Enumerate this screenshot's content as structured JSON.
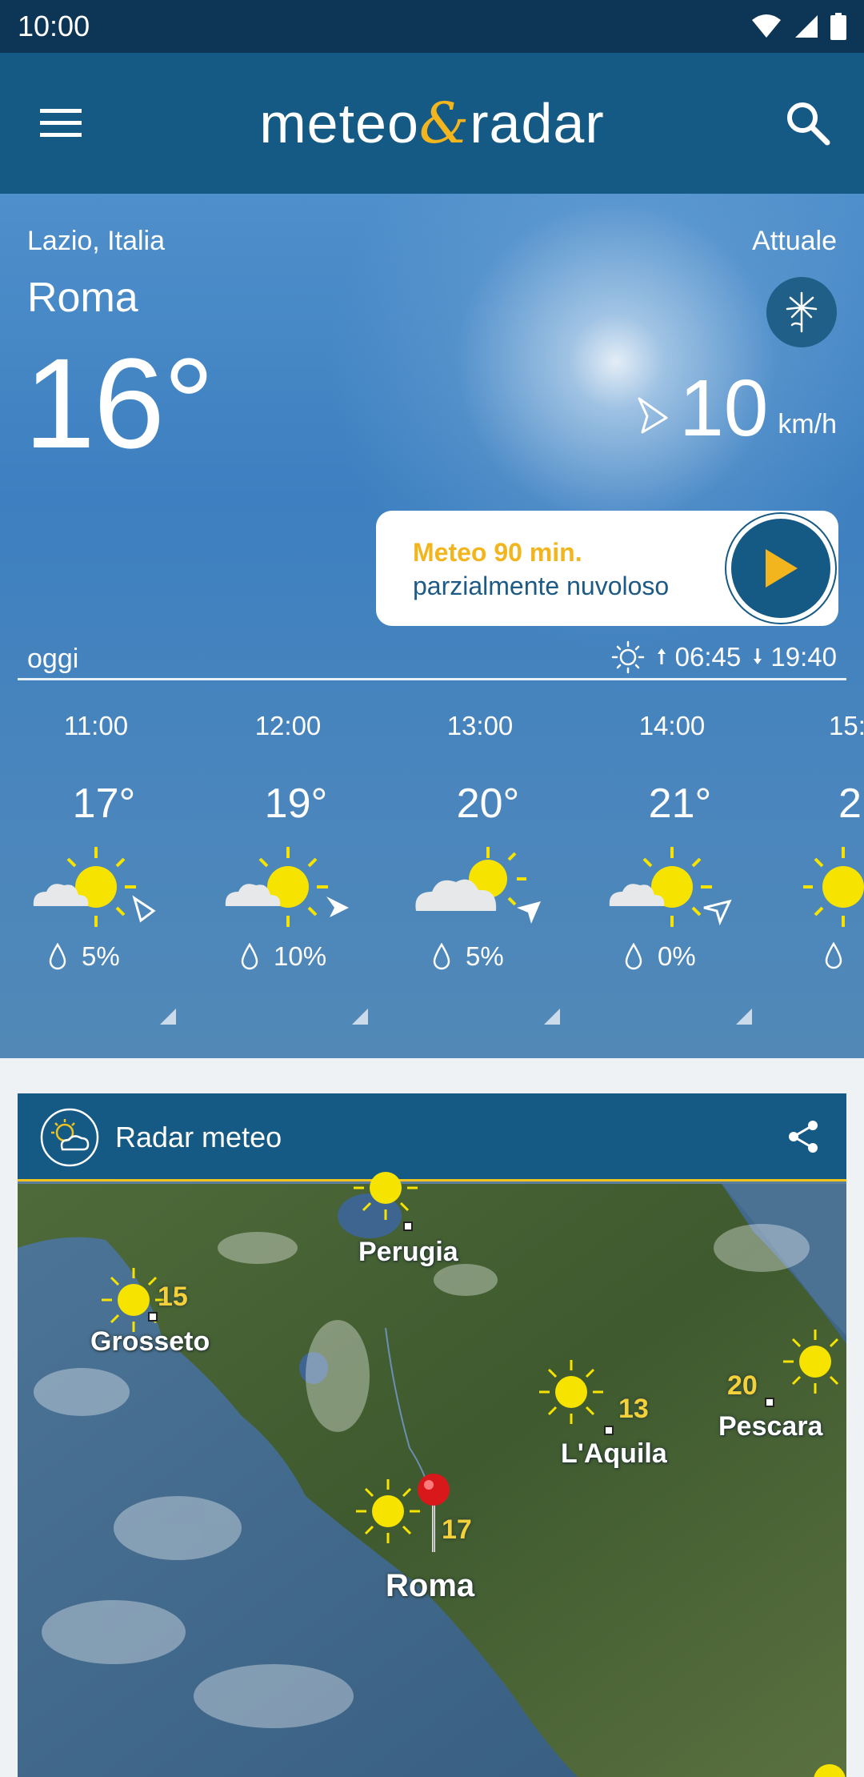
{
  "status_bar": {
    "time": "10:00"
  },
  "app_bar": {
    "brand_left": "meteo",
    "brand_amp": "&",
    "brand_right": "radar"
  },
  "current": {
    "region": "Lazio, Italia",
    "label": "Attuale",
    "city": "Roma",
    "temperature": "16°",
    "wind_speed": "10",
    "wind_unit": "km/h"
  },
  "nowcast": {
    "title": "Meteo 90 min.",
    "description": "parzialmente nuvoloso"
  },
  "today": {
    "label": "oggi",
    "sunrise": "06:45",
    "sunset": "19:40"
  },
  "hourly": [
    {
      "time": "11:00",
      "temp": "17°",
      "rain": "5%",
      "icon": "partly-sunny-icon"
    },
    {
      "time": "12:00",
      "temp": "19°",
      "rain": "10%",
      "icon": "partly-sunny-icon"
    },
    {
      "time": "13:00",
      "temp": "20°",
      "rain": "5%",
      "icon": "partly-cloudy-icon"
    },
    {
      "time": "14:00",
      "temp": "21°",
      "rain": "0%",
      "icon": "partly-sunny-icon"
    },
    {
      "time": "15:",
      "temp": "2",
      "rain": "",
      "icon": "sunny-icon"
    }
  ],
  "radar": {
    "title": "Radar meteo",
    "cities": [
      {
        "name": "Perugia"
      },
      {
        "name": "Grosseto",
        "temp": "15"
      },
      {
        "name": "L'Aquila",
        "temp": "13"
      },
      {
        "name": "Pescara",
        "temp": "20"
      },
      {
        "name": "Roma",
        "temp": "17"
      }
    ]
  },
  "colors": {
    "primary": "#155a84",
    "accent": "#f2b51d",
    "status_bar": "#0d3656"
  }
}
